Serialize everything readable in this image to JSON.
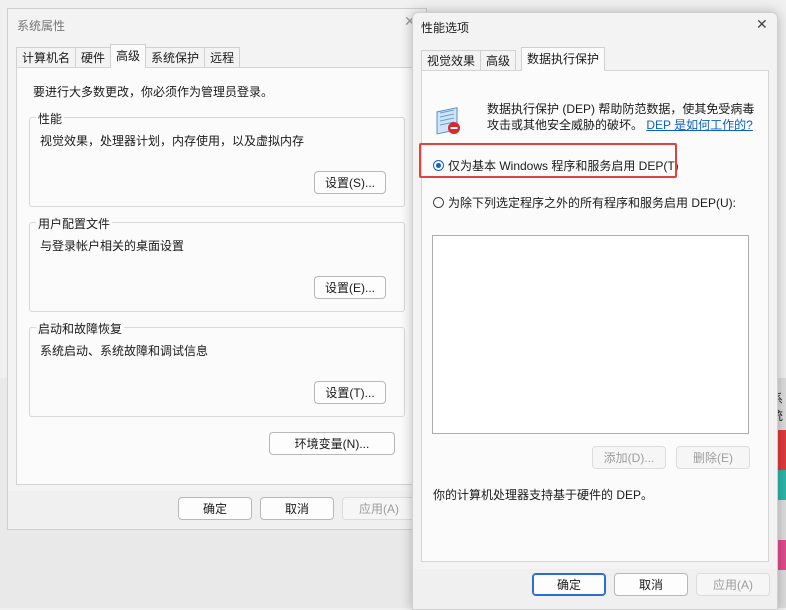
{
  "background": {
    "text": "系统"
  },
  "win1": {
    "title": "系统属性",
    "close": "✕",
    "tabs": [
      "计算机名",
      "硬件",
      "高级",
      "系统保护",
      "远程"
    ],
    "info": "要进行大多数更改，你必须作为管理员登录。",
    "groups": [
      {
        "label": "性能",
        "desc": "视觉效果，处理器计划，内存使用，以及虚拟内存",
        "button": "设置(S)..."
      },
      {
        "label": "用户配置文件",
        "desc": "与登录帐户相关的桌面设置",
        "button": "设置(E)..."
      },
      {
        "label": "启动和故障恢复",
        "desc": "系统启动、系统故障和调试信息",
        "button": "设置(T)..."
      }
    ],
    "env_button": "环境变量(N)...",
    "ok": "确定",
    "cancel": "取消",
    "apply": "应用(A)"
  },
  "win2": {
    "title": "性能选项",
    "close": "✕",
    "tabs": [
      "视觉效果",
      "高级",
      "数据执行保护"
    ],
    "dep_desc": "数据执行保护 (DEP) 帮助防范数据，使其免受病毒攻击或其他安全威胁的破坏。",
    "dep_link": "DEP 是如何工作的?",
    "option1": "仅为基本 Windows 程序和服务启用 DEP(T)",
    "option2": "为除下列选定程序之外的所有程序和服务启用 DEP(U):",
    "add": "添加(D)...",
    "remove": "删除(E)",
    "support": "你的计算机处理器支持基于硬件的 DEP。",
    "ok": "确定",
    "cancel": "取消",
    "apply": "应用(A)"
  },
  "colors": {
    "accent": "#1560c0",
    "highlight": "#e0423f",
    "link": "#0b62c4"
  }
}
